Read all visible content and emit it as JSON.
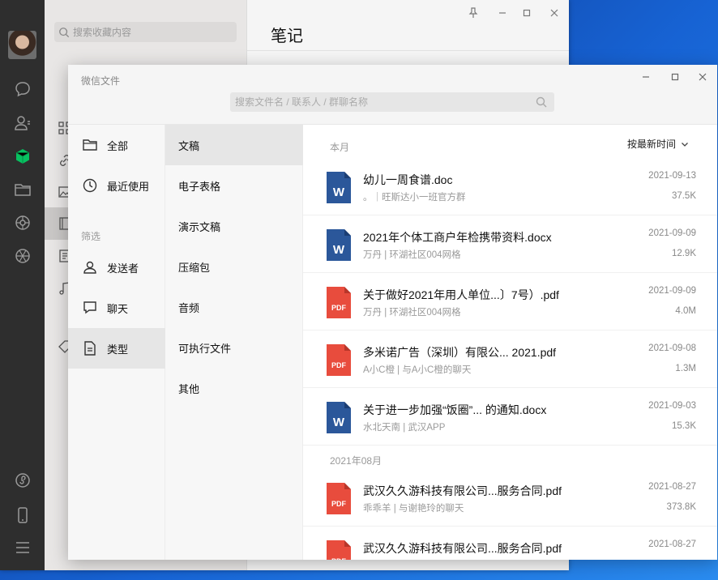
{
  "wechat_bg": {
    "favorites_search_placeholder": "搜索收藏内容",
    "title": "笔记",
    "rail_icons": [
      "chat-icon",
      "contacts-icon",
      "favorites-icon",
      "folder-icon",
      "moments-icon",
      "channels-icon",
      "miniprogram-icon",
      "phone-icon",
      "menu-icon"
    ]
  },
  "window": {
    "title": "微信文件",
    "search_placeholder": "搜索文件名 / 联系人 / 群聊名称"
  },
  "nav1": {
    "all": "全部",
    "recent": "最近使用",
    "filter_section": "筛选",
    "sender": "发送者",
    "chat": "聊天",
    "type": "类型"
  },
  "nav2": [
    "文稿",
    "电子表格",
    "演示文稿",
    "压缩包",
    "音频",
    "可执行文件",
    "其他"
  ],
  "list": {
    "sort_label": "按最新时间",
    "groups": [
      {
        "label": "本月",
        "files": [
          {
            "type": "word",
            "name": "幼儿一周食谱.doc",
            "source": "。｜旺斯达小一班官方群",
            "date": "2021-09-13",
            "size": "37.5K"
          },
          {
            "type": "word",
            "name": "2021年个体工商户年检携带资料.docx",
            "source": "万丹 | 环湖社区004网格",
            "date": "2021-09-09",
            "size": "12.9K"
          },
          {
            "type": "pdf",
            "name": "关于做好2021年用人单位...〕7号）.pdf",
            "source": "万丹 | 环湖社区004网格",
            "date": "2021-09-09",
            "size": "4.0M"
          },
          {
            "type": "pdf",
            "name": "多米诺广告（深圳）有限公...  2021.pdf",
            "source": "A小C橙 | 与A小C橙的聊天",
            "date": "2021-09-08",
            "size": "1.3M"
          },
          {
            "type": "word",
            "name": "关于进一步加强“饭圈”... 的通知.docx",
            "source": "水北天南 | 武汉APP",
            "date": "2021-09-03",
            "size": "15.3K"
          }
        ]
      },
      {
        "label": "2021年08月",
        "files": [
          {
            "type": "pdf",
            "name": "武汉久久游科技有限公司...服务合同.pdf",
            "source": "乖乖羊 | 与谢艳玲的聊天",
            "date": "2021-08-27",
            "size": "373.8K"
          },
          {
            "type": "pdf",
            "name": "武汉久久游科技有限公司...服务合同.pdf",
            "source": "",
            "date": "2021-08-27",
            "size": ""
          }
        ]
      }
    ]
  },
  "icon_labels": {
    "word": "W",
    "pdf": "PDF"
  },
  "colors": {
    "word": "#2b579a",
    "pdf": "#e84c3d",
    "wechat_green": "#07c160"
  }
}
